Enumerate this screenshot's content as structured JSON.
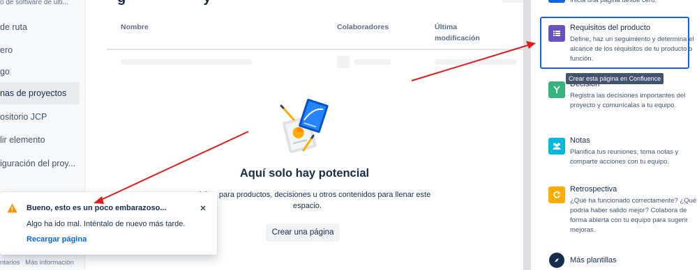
{
  "sidebar": {
    "top_text": "o de software de últi...",
    "items": [
      {
        "label": "de ruta"
      },
      {
        "label": "ero"
      },
      {
        "label": "go"
      },
      {
        "label": "nas de proyectos"
      },
      {
        "label": "ositorio JCP"
      },
      {
        "label": "lir elemento"
      },
      {
        "label": "iguración del proy..."
      }
    ],
    "footer": {
      "left": "ntarios",
      "right": "Más información"
    }
  },
  "main": {
    "columns": {
      "name": "Nombre",
      "collaborators": "Colaboradores",
      "last_modified": "Última modificación"
    },
    "empty_state": {
      "title": "Aquí solo hay potencial",
      "description": "requisitos para productos, decisiones u otros contenidos para llenar este espacio.",
      "create_button": "Crear una página"
    }
  },
  "templates": {
    "top_desc": "Inicia una página desde cero.",
    "items": [
      {
        "name": "Requisitos del producto",
        "desc": "Define, haz un seguimiento y determina el alcance de los requisitos de tu producto o función.",
        "color": "#6554c0",
        "icon": "list-icon"
      },
      {
        "name": "Decisión",
        "desc": "Registra las decisiones importantes del proyecto y comunícalas a tu equipo.",
        "color": "#36b37e",
        "icon": "branch-icon"
      },
      {
        "name": "Notas",
        "desc": "Planifica tus reuniones, toma notas y comparte acciones con tu equipo.",
        "color": "#00b8d9",
        "icon": "people-icon"
      },
      {
        "name": "Retrospectiva",
        "desc": "¿Qué ha funcionado correctamente? ¿Qué podría haber salido mejor? Colabora de forma abierta con tu equipo para sugerir mejoras.",
        "color": "#ffab00",
        "icon": "refresh-icon"
      }
    ],
    "more": "Más plantillas",
    "tooltip": "Crear esta página en Confluence"
  },
  "flag": {
    "title": "Bueno, esto es un poco embarazoso...",
    "body": "Algo ha ido mal. Inténtalo de nuevo más tarde.",
    "link": "Recargar página"
  },
  "colors": {
    "accent": "#0c66e4",
    "warning": "#ff8b00",
    "arrow": "#e01b1b"
  }
}
